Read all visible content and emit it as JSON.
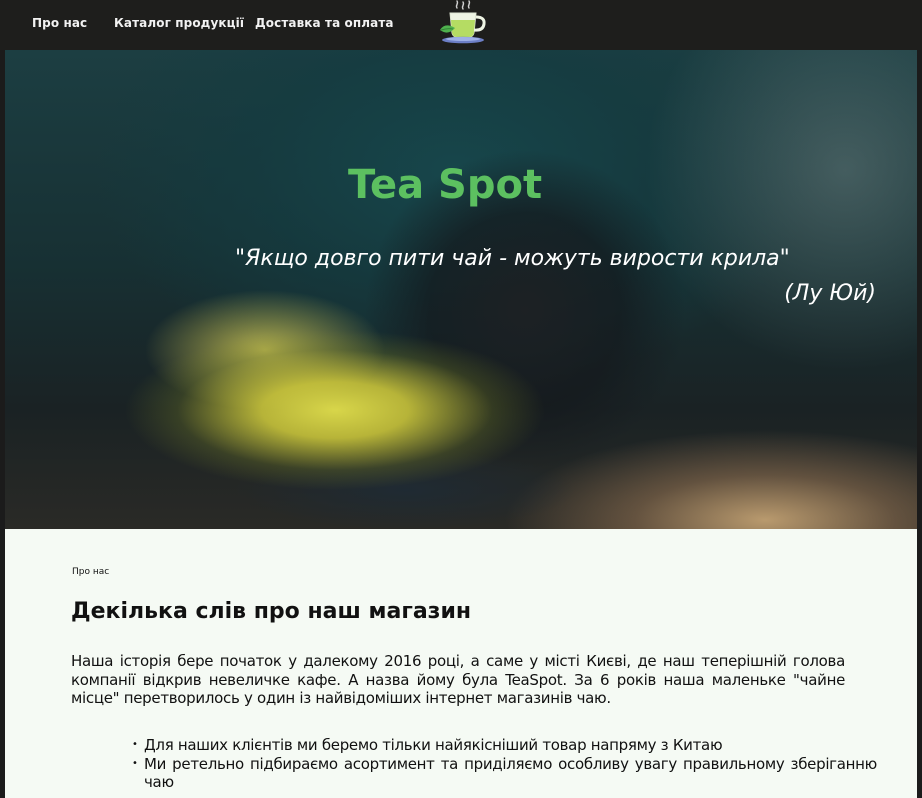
{
  "nav": {
    "items": [
      {
        "label": "Про нас"
      },
      {
        "label": "Каталог продукції"
      },
      {
        "label": "Доставка та оплата"
      }
    ]
  },
  "logo": {
    "icon": "tea-cup-logo-icon"
  },
  "hero": {
    "title": "Tea Spot",
    "quote": "\"Якщо довго пити чай - можуть вирости крила\"",
    "author": "(Лу Юй)"
  },
  "about": {
    "breadcrumb": "Про нас",
    "title": "Декілька слів про наш магазин",
    "intro": "Наша історія бере початок у далекому 2016 році, а саме у місті Києві, де наш теперішній голова компанії відкрив невеличке кафе. А назва йому була TeaSpot. За 6 років наша маленьке \"чайне місце\" перетворилось у один із найвідоміших інтернет магазинів чаю.",
    "features": [
      "Для наших клієнтів ми беремо тільки найякісніший товар напряму з Китаю",
      "Ми ретельно підбираємо асортимент та приділяємо особливу увагу правильному зберіганню чаю"
    ]
  },
  "colors": {
    "nav_bg": "#1e1e1c",
    "title_green": "#5cc060",
    "content_bg": "#f5faf4"
  }
}
